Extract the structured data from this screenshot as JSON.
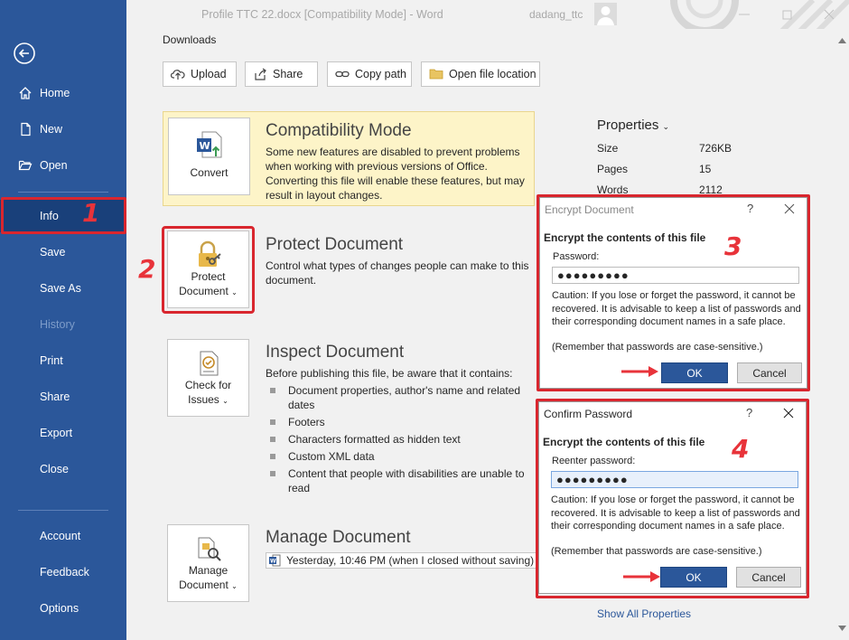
{
  "window": {
    "title": "Profile TTC 22.docx [Compatibility Mode]  -  Word",
    "username": "dadang_ttc"
  },
  "sidebar": {
    "items": [
      {
        "label": "Home"
      },
      {
        "label": "New"
      },
      {
        "label": "Open"
      },
      {
        "label": "Info"
      },
      {
        "label": "Save"
      },
      {
        "label": "Save As"
      },
      {
        "label": "History"
      },
      {
        "label": "Print"
      },
      {
        "label": "Share"
      },
      {
        "label": "Export"
      },
      {
        "label": "Close"
      },
      {
        "label": "Account"
      },
      {
        "label": "Feedback"
      },
      {
        "label": "Options"
      }
    ]
  },
  "location": {
    "path": "Downloads"
  },
  "actions": {
    "upload": "Upload",
    "share": "Share",
    "copy_path": "Copy path",
    "open_location": "Open file location"
  },
  "compat": {
    "tile": "Convert",
    "title": "Compatibility Mode",
    "desc": "Some new features are disabled to prevent problems when working with previous versions of Office. Converting this file will enable these features, but may result in layout changes."
  },
  "protect": {
    "tile_line1": "Protect",
    "tile_line2": "Document",
    "title": "Protect Document",
    "desc": "Control what types of changes people can make to this document."
  },
  "inspect": {
    "tile_line1": "Check for",
    "tile_line2": "Issues",
    "title": "Inspect Document",
    "desc": "Before publishing this file, be aware that it contains:",
    "bullets": [
      "Document properties, author's name and related dates",
      "Footers",
      "Characters formatted as hidden text",
      "Custom XML data",
      "Content that people with disabilities are unable to read"
    ]
  },
  "manage": {
    "tile_line1": "Manage",
    "tile_line2": "Document",
    "title": "Manage Document",
    "version": "Yesterday, 10:46 PM (when I closed without saving)"
  },
  "properties": {
    "title": "Properties",
    "rows": [
      {
        "key": "Size",
        "value": "726KB"
      },
      {
        "key": "Pages",
        "value": "15"
      },
      {
        "key": "Words",
        "value": "2112"
      }
    ],
    "show_all": "Show All Properties"
  },
  "encrypt_dialog": {
    "title": "Encrypt Document",
    "help": "?",
    "heading": "Encrypt the contents of this file",
    "label": "Password:",
    "value": "●●●●●●●●●",
    "caution": "Caution: If you lose or forget the password, it cannot be recovered. It is advisable to keep a list of passwords and their corresponding document names in a safe place.",
    "caution_note": "(Remember that passwords are case-sensitive.)",
    "ok": "OK",
    "cancel": "Cancel"
  },
  "confirm_dialog": {
    "title": "Confirm Password",
    "help": "?",
    "heading": "Encrypt the contents of this file",
    "label": "Reenter password:",
    "value": "●●●●●●●●●",
    "caution": "Caution: If you lose or forget the password, it cannot be recovered. It is advisable to keep a list of passwords and their corresponding document names in a safe place.",
    "caution_note": "(Remember that passwords are case-sensitive.)",
    "ok": "OK",
    "cancel": "Cancel"
  },
  "steps": {
    "s1": "1",
    "s2": "2",
    "s3": "3",
    "s4": "4"
  },
  "colors": {
    "sidebar": "#2b579a",
    "active": "#19407a",
    "annotation": "#d9262e",
    "compat_bg": "#fdf4c8"
  },
  "icons": [
    "back-arrow-icon",
    "home-icon",
    "new-document-icon",
    "open-folder-icon",
    "upload-icon",
    "share-icon",
    "link-icon",
    "folder-icon",
    "word-convert-icon",
    "lock-key-icon",
    "check-issues-icon",
    "manage-document-icon",
    "close-icon",
    "help-icon",
    "red-arrow-icon"
  ]
}
